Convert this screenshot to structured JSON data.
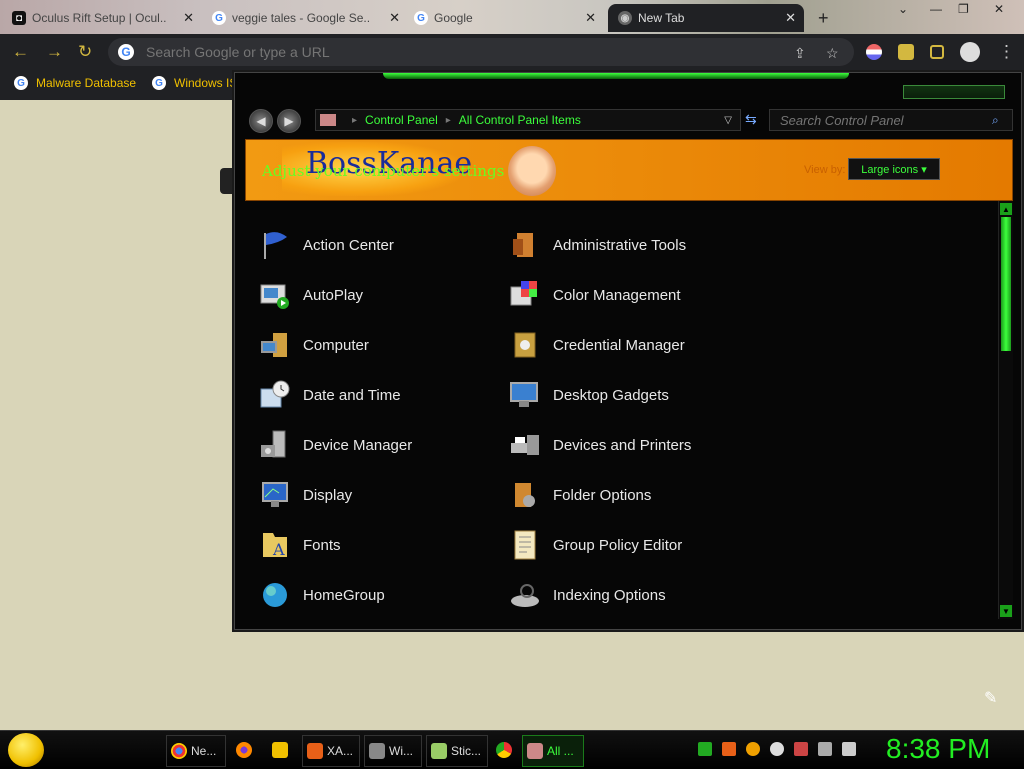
{
  "browser": {
    "tabs": [
      {
        "title": "Oculus Rift Setup | Ocul..",
        "active": false
      },
      {
        "title": "veggie tales - Google Se..",
        "active": false
      },
      {
        "title": "Google",
        "active": false
      },
      {
        "title": "New Tab",
        "active": true
      }
    ],
    "new_tab_label": "+",
    "omnibox": {
      "placeholder": "Search Google or type a URL",
      "value": ""
    },
    "bookmarks": [
      {
        "label": "Malware Database"
      },
      {
        "label": "Windows IS"
      }
    ]
  },
  "control_panel": {
    "breadcrumb": [
      "Control Panel",
      "All Control Panel Items"
    ],
    "search_placeholder": "Search Control Panel",
    "banner": {
      "brand": "BossKanae",
      "subtitle": "Adjust your computer's settings",
      "view_by_label": "View by:",
      "view_by_value": "Large icons ▾"
    },
    "items_left": [
      {
        "label": "Action Center",
        "icon": "flag-icon"
      },
      {
        "label": "AutoPlay",
        "icon": "autoplay-icon"
      },
      {
        "label": "Computer",
        "icon": "computer-icon"
      },
      {
        "label": "Date and Time",
        "icon": "clock-icon"
      },
      {
        "label": "Device Manager",
        "icon": "device-manager-icon"
      },
      {
        "label": "Display",
        "icon": "display-icon"
      },
      {
        "label": "Fonts",
        "icon": "fonts-icon"
      },
      {
        "label": "HomeGroup",
        "icon": "homegroup-icon"
      }
    ],
    "items_right": [
      {
        "label": "Administrative Tools",
        "icon": "admin-tools-icon"
      },
      {
        "label": "Color Management",
        "icon": "color-management-icon"
      },
      {
        "label": "Credential Manager",
        "icon": "credential-icon"
      },
      {
        "label": "Desktop Gadgets",
        "icon": "gadgets-icon"
      },
      {
        "label": "Devices and Printers",
        "icon": "printer-icon"
      },
      {
        "label": "Folder Options",
        "icon": "folder-options-icon"
      },
      {
        "label": "Group Policy Editor",
        "icon": "policy-icon"
      },
      {
        "label": "Indexing Options",
        "icon": "indexing-icon"
      }
    ]
  },
  "taskbar": {
    "buttons": [
      {
        "label": "Ne..."
      },
      {
        "label": ""
      },
      {
        "label": ""
      },
      {
        "label": "XA..."
      },
      {
        "label": "Wi..."
      },
      {
        "label": "Stic..."
      },
      {
        "label": ""
      },
      {
        "label": "All ..."
      }
    ],
    "clock": "8:38 PM"
  },
  "colors": {
    "accent_green": "#3cff3c",
    "banner_orange": "#f29a12",
    "chrome_dark": "#202124"
  }
}
